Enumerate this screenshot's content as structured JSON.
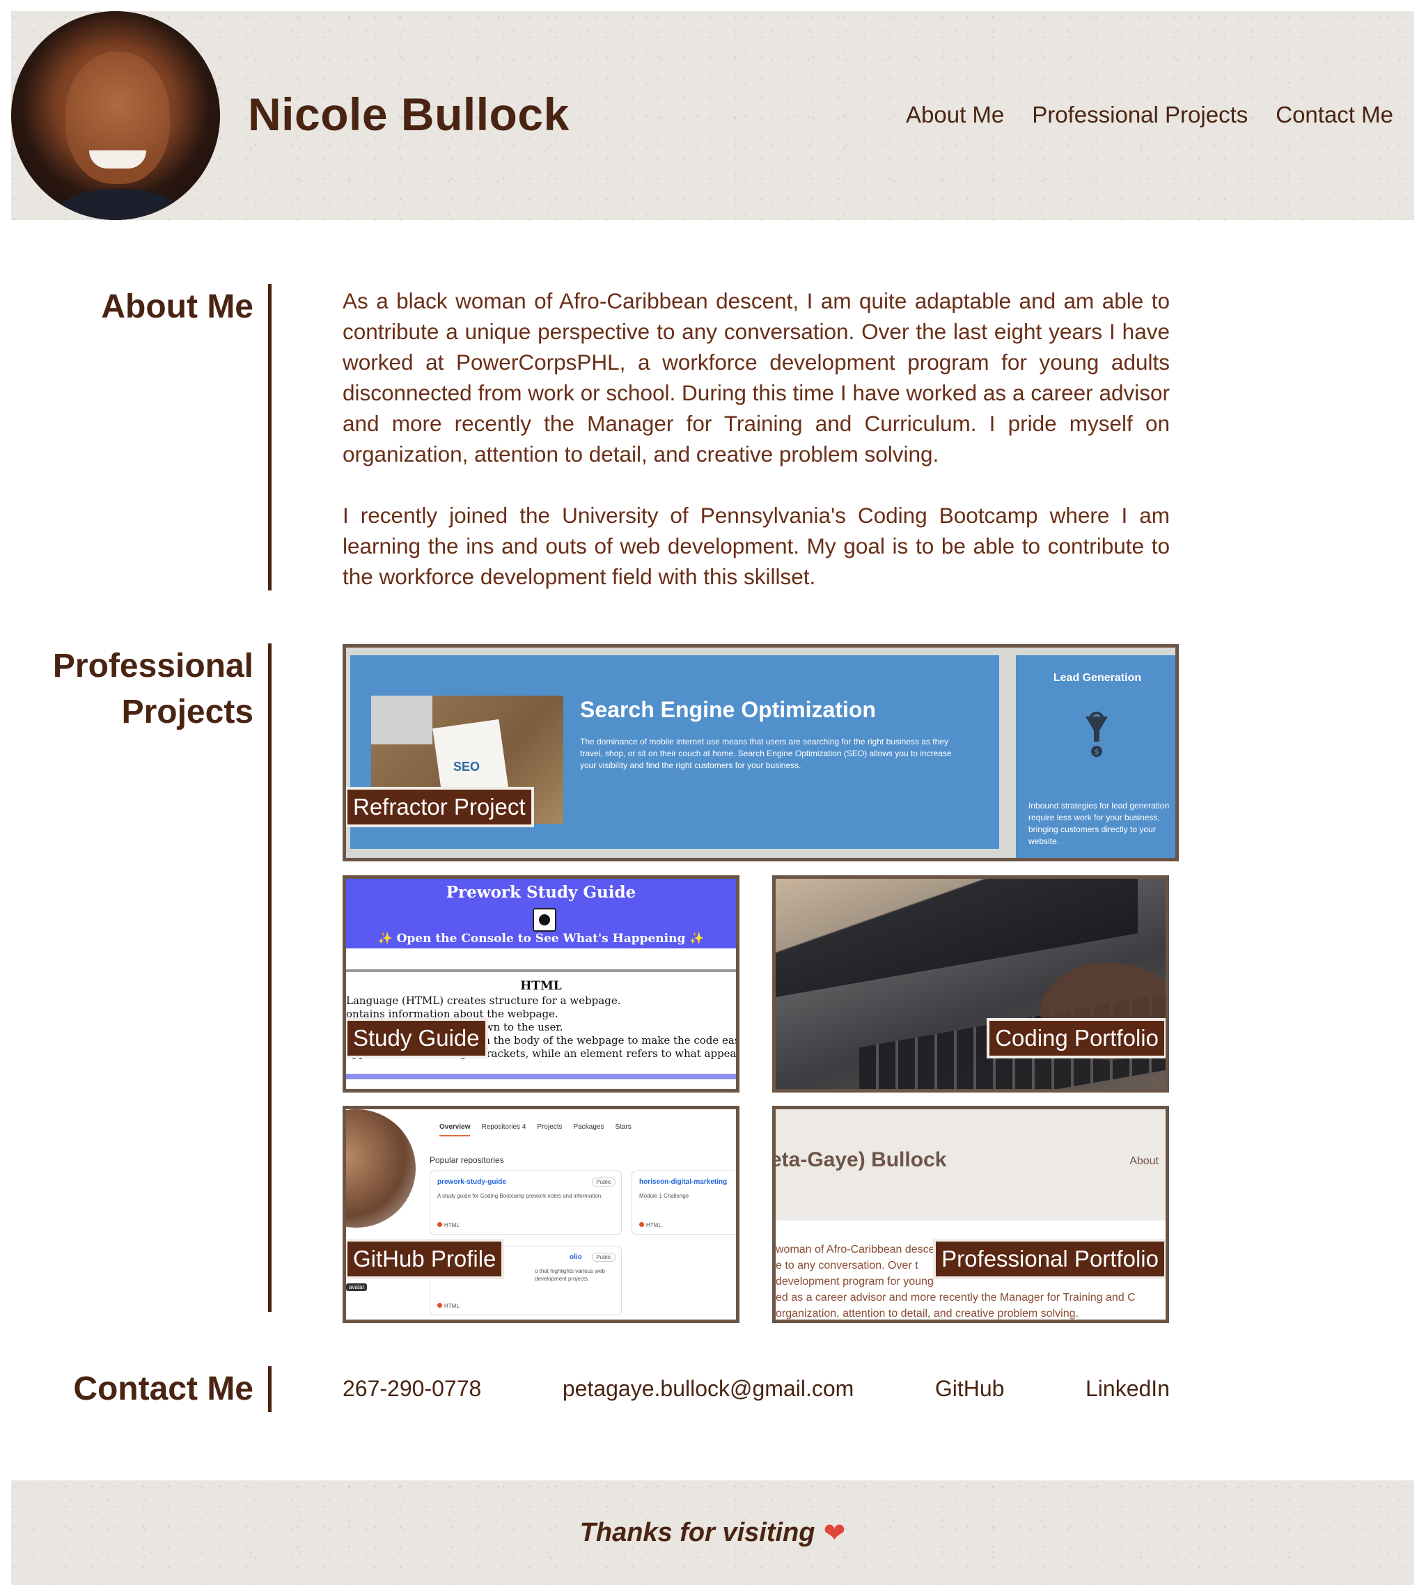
{
  "header": {
    "name": "Nicole Bullock",
    "nav": [
      "About Me",
      "Professional Projects",
      "Contact Me"
    ]
  },
  "about": {
    "title": "About Me",
    "paragraphs": [
      "As a black woman of Afro-Caribbean descent, I am quite adaptable and am able to contribute a unique perspective to any conversation. Over the last eight years I have worked at PowerCorpsPHL, a workforce development program for young adults disconnected from work or school. During this time I have worked as a career advisor and more recently the Manager for Training and Curriculum. I pride myself on organization, attention to detail, and creative problem solving.",
      "I recently joined the University of Pennsylvania's Coding Bootcamp where I am learning the ins and outs of web development. My goal is to be able to contribute to the workforce development field with this skillset."
    ]
  },
  "projects": {
    "title_line1": "Professional",
    "title_line2": "Projects",
    "cards": [
      {
        "label": "Refractor Project",
        "preview": {
          "heading": "Search Engine Optimization",
          "body": "The dominance of mobile internet use means that users are searching for the right business as they travel, shop, or sit on their couch at home. Search Engine Optimization (SEO) allows you to increase your visibility and find the right customers for your business.",
          "side_title": "Lead Generation",
          "side_body": "Inbound strategies for lead generation require less work for your business, bringing customers directly to your website.",
          "photo_text": "SEO"
        }
      },
      {
        "label": "Study Guide",
        "preview": {
          "title": "Prework Study Guide",
          "subtitle": "✨ Open the Console to See What's Happening ✨",
          "section": "HTML",
          "lines": [
            "Language (HTML) creates structure for a webpage.",
            "ontains information about the webpage.",
            "hown to the user.",
            "s in the body of the webpage to make the code easy to re",
            "appears inside the angle brackets, while an element refers to what appears from openi"
          ]
        }
      },
      {
        "label": "Coding Portfolio"
      },
      {
        "label": "GitHub Profile",
        "preview": {
          "tabs": [
            "Overview",
            "Repositories 4",
            "Projects",
            "Packages",
            "Stars"
          ],
          "popular": "Popular repositories",
          "repos": [
            {
              "name": "prework-study-guide",
              "badge": "Public",
              "desc": "A study guide for Coding Bootcamp prework notes and information.",
              "lang": "HTML"
            },
            {
              "name": "horiseon-digital-marketing",
              "badge": "",
              "desc": "Module 1 Challenge",
              "lang": "HTML"
            },
            {
              "name": "olio",
              "badge": "Public",
              "desc": "o that highlights various web development projects.",
              "lang": "HTML"
            }
          ],
          "avatar_label": "avatar"
        }
      },
      {
        "label": "Professional Portfolio",
        "preview": {
          "name": "eta-Gaye) Bullock",
          "nav": "About",
          "lines": [
            "woman of Afro-Caribbean desce",
            "e  to  any  conversation.  Over  t",
            "development program for young",
            "ed as a career advisor and more recently the Manager for Training and C",
            "organization, attention to detail, and creative problem solving."
          ]
        }
      }
    ]
  },
  "contact": {
    "title": "Contact Me",
    "phone": "267-290-0778",
    "email": "petagaye.bullock@gmail.com",
    "github": "GitHub",
    "linkedin": "LinkedIn"
  },
  "footer": {
    "text": "Thanks for visiting",
    "emoji": "❤"
  },
  "colors": {
    "brand_brown": "#4a2412",
    "label_bg": "#5b2814",
    "paper": "#e9e5e0",
    "seo_blue": "#5190cb",
    "study_guide_purple": "#5a5af2"
  }
}
